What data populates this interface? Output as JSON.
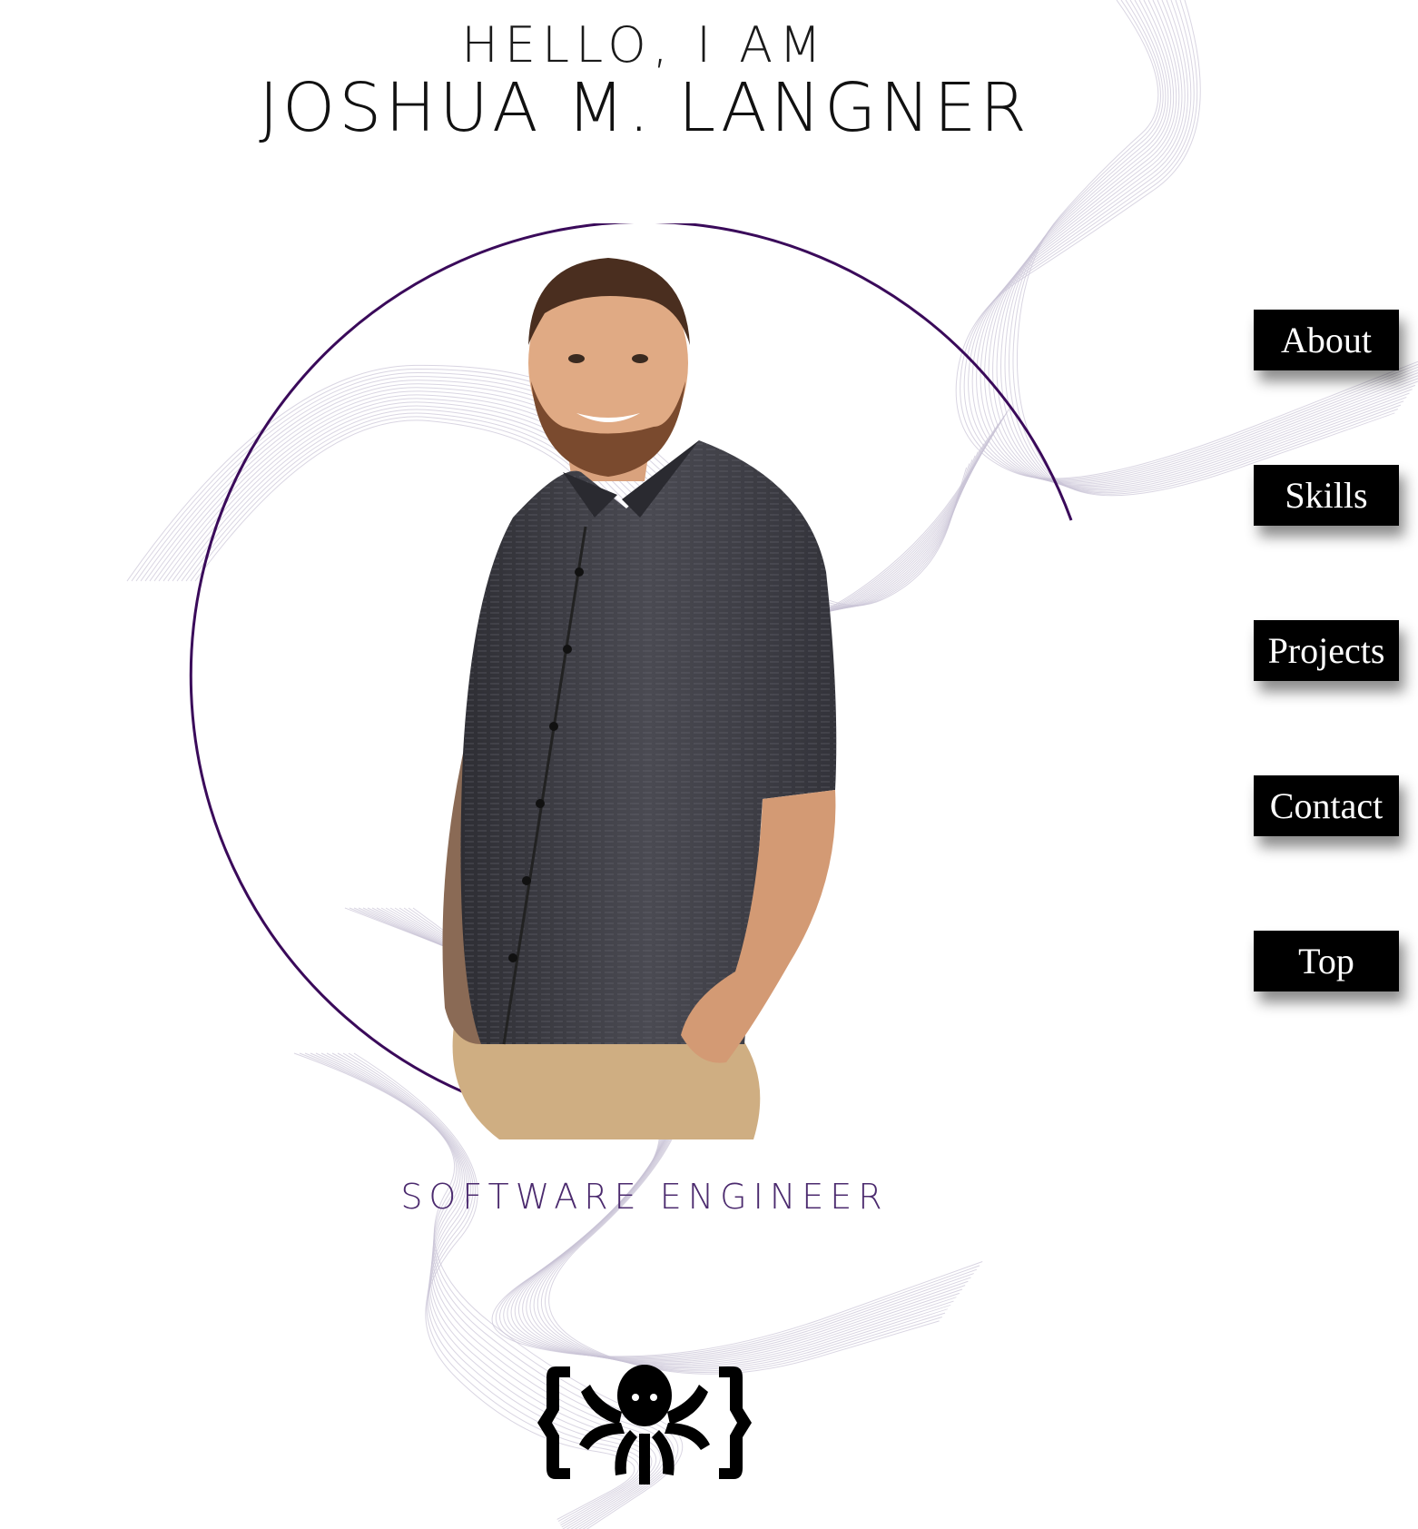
{
  "hero": {
    "greeting": "HELLO, I AM",
    "name": "JOSHUA M. LANGNER",
    "tagline": "SOFTWARE ENGINEER"
  },
  "nav": {
    "items": [
      {
        "label": "About"
      },
      {
        "label": "Skills"
      },
      {
        "label": "Projects"
      },
      {
        "label": "Contact"
      },
      {
        "label": "Top"
      }
    ]
  },
  "colors": {
    "accent": "#3a0a5a",
    "wave": "#c9c3d6",
    "tagline": "#4b2a6e",
    "nav_bg": "#000000",
    "nav_text": "#ffffff"
  },
  "icons": {
    "logo": "octopus-braces-logo"
  }
}
